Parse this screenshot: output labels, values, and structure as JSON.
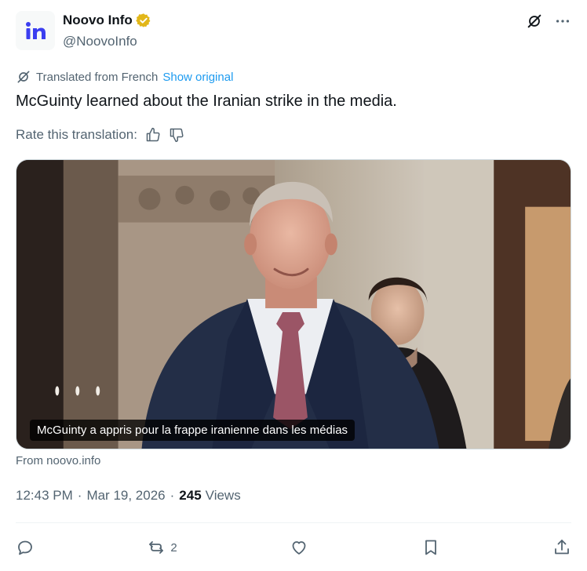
{
  "account": {
    "display_name": "Noovo Info",
    "handle": "@NoovoInfo",
    "avatar_icon": "noovo-logo",
    "verified_icon": "gold-verified-badge",
    "verified_color": "#e2b719"
  },
  "header_actions": {
    "grok_icon": "grok-icon",
    "more_icon": "more-dots-icon"
  },
  "translation": {
    "label": "Translated from French",
    "show_original": "Show original",
    "rate_label": "Rate this translation:",
    "thumbs_up_icon": "thumbs-up-icon",
    "thumbs_down_icon": "thumbs-down-icon"
  },
  "tweet": {
    "text": "McGuinty learned about the Iranian strike in the media."
  },
  "media": {
    "caption": "McGuinty a appris pour la frappe iranienne dans les médias",
    "source": "From noovo.info"
  },
  "meta": {
    "time": "12:43 PM",
    "separator": "·",
    "date": "Mar 19, 2026",
    "views_count": "245",
    "views_label": "Views"
  },
  "actions": {
    "reply_icon": "reply-icon",
    "repost_icon": "repost-icon",
    "repost_count": "2",
    "like_icon": "heart-icon",
    "bookmark_icon": "bookmark-icon",
    "share_icon": "share-icon"
  },
  "colors": {
    "text_primary": "#0f1419",
    "text_secondary": "#536471",
    "link": "#1d9bf0",
    "brand_blue": "#3b3ef0"
  }
}
